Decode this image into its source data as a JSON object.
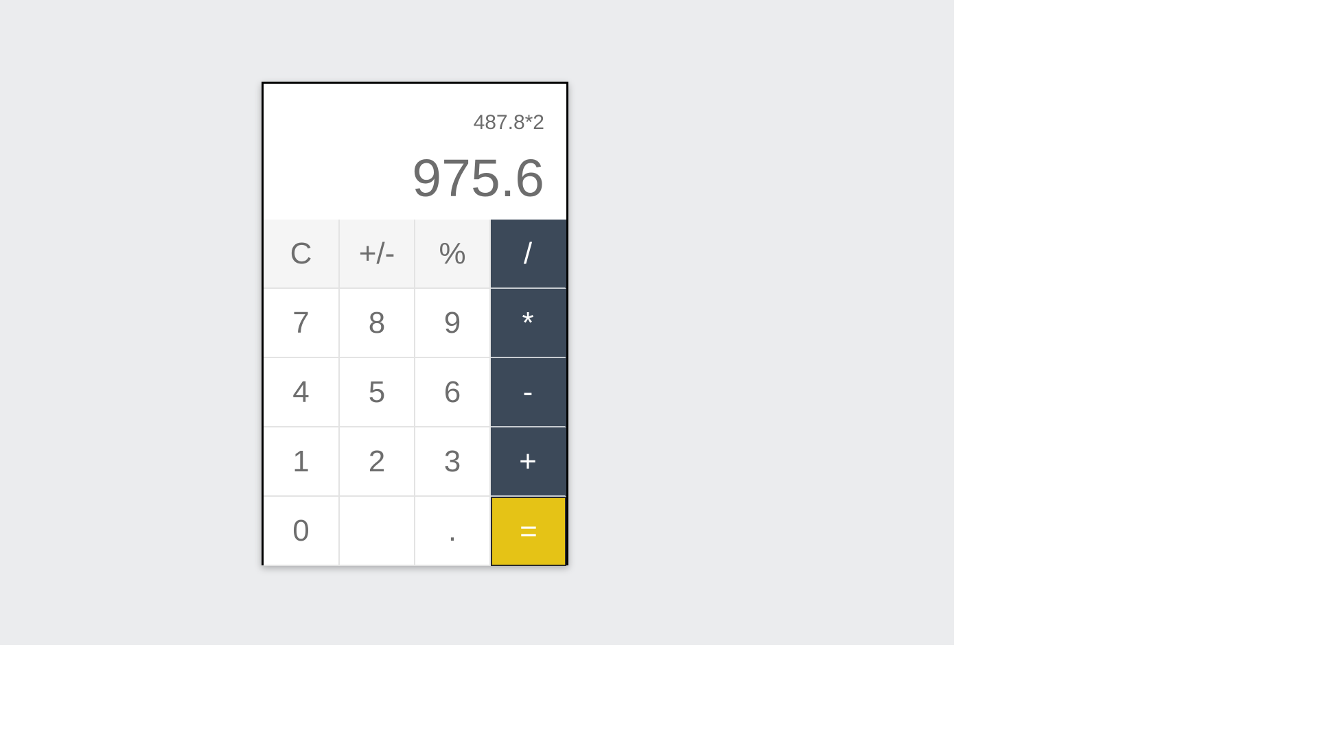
{
  "display": {
    "expression": "487.8*2",
    "result": "975.6"
  },
  "keys": {
    "clear": "C",
    "negate": "+/-",
    "percent": "%",
    "divide": "/",
    "seven": "7",
    "eight": "8",
    "nine": "9",
    "multiply": "*",
    "four": "4",
    "five": "5",
    "six": "6",
    "subtract": "-",
    "one": "1",
    "two": "2",
    "three": "3",
    "add": "+",
    "zero": "0",
    "blank": "",
    "decimal": ".",
    "equals": "="
  },
  "colors": {
    "background": "#ebecee",
    "operator": "#3c4959",
    "equals": "#e5c316",
    "function_key": "#f5f5f5",
    "text": "#6d6d6d"
  }
}
